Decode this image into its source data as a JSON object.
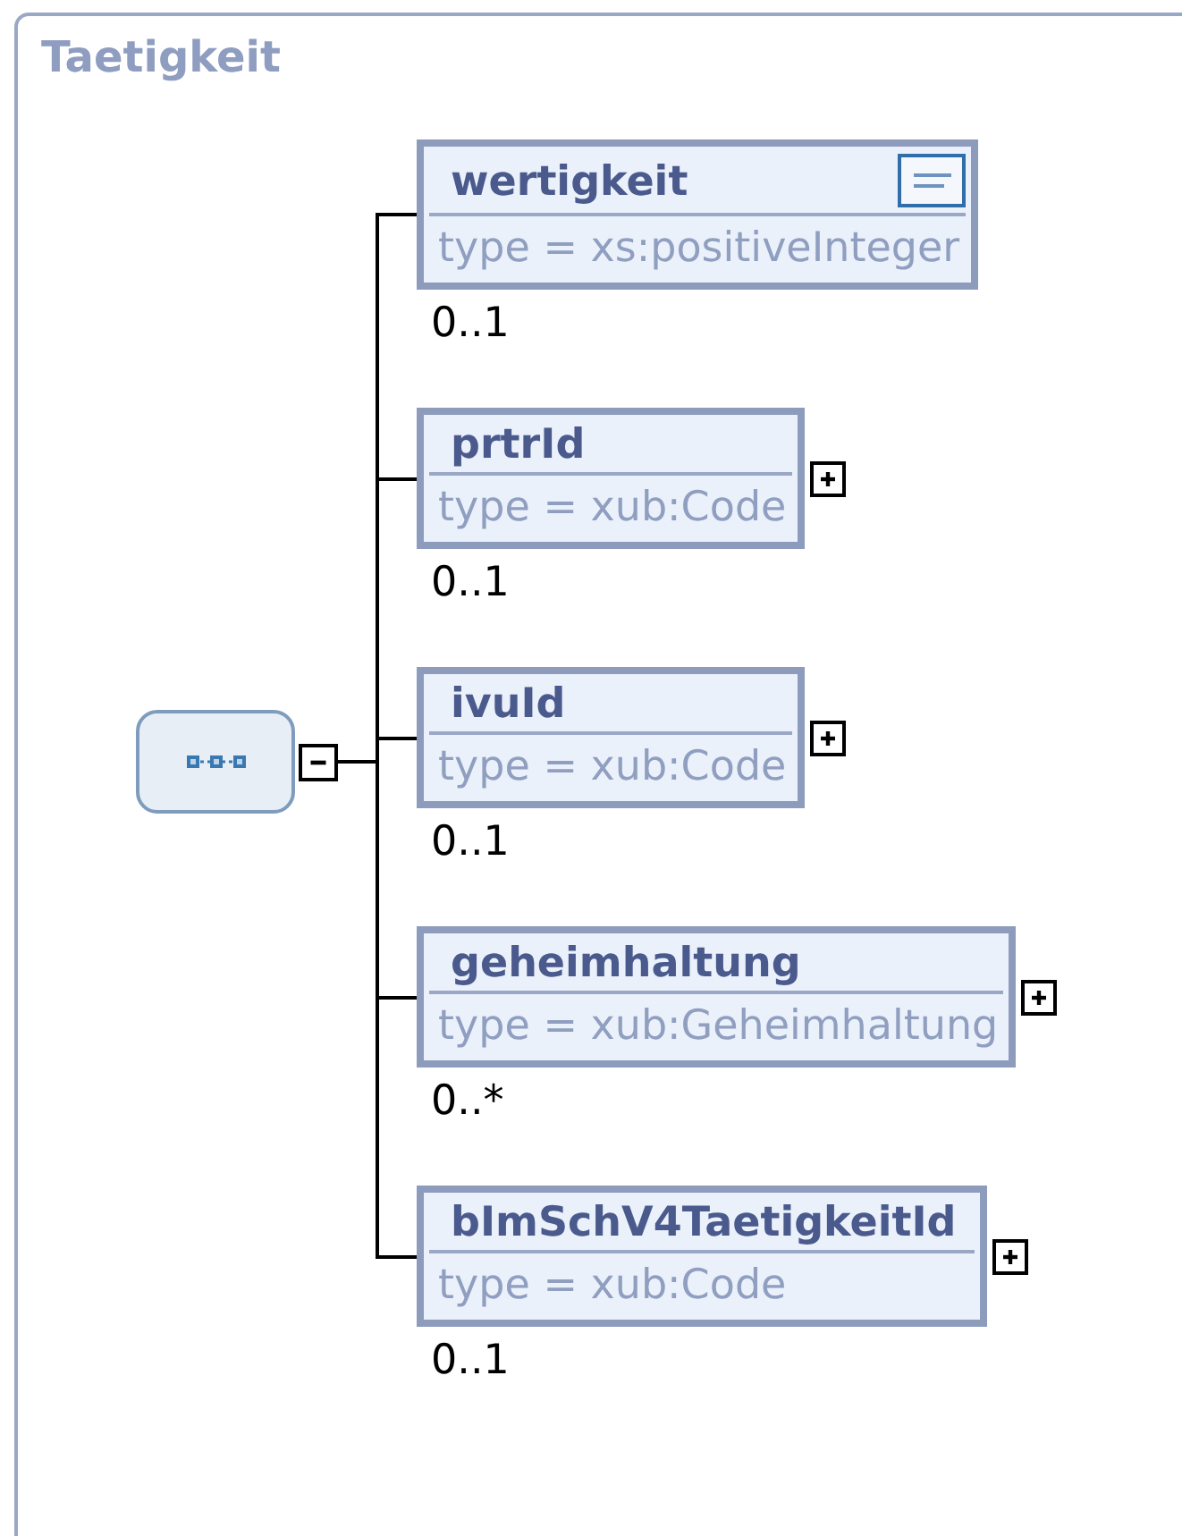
{
  "title": "Taetigkeit",
  "compositor": {
    "expanded": true
  },
  "elements": [
    {
      "name": "wertigkeit",
      "type": "type = xs:positiveInteger",
      "multiplicity": "0..1",
      "annotated": true,
      "collapsed": false
    },
    {
      "name": "prtrId",
      "type": "type = xub:Code",
      "multiplicity": "0..1",
      "annotated": false,
      "collapsed": true
    },
    {
      "name": "ivuId",
      "type": "type = xub:Code",
      "multiplicity": "0..1",
      "annotated": false,
      "collapsed": true
    },
    {
      "name": "geheimhaltung",
      "type": "type = xub:Geheimhaltung",
      "multiplicity": "0..*",
      "annotated": false,
      "collapsed": true
    },
    {
      "name": "bImSchV4TaetigkeitId",
      "type": "type = xub:Code",
      "multiplicity": "0..1",
      "annotated": false,
      "collapsed": true
    }
  ]
}
